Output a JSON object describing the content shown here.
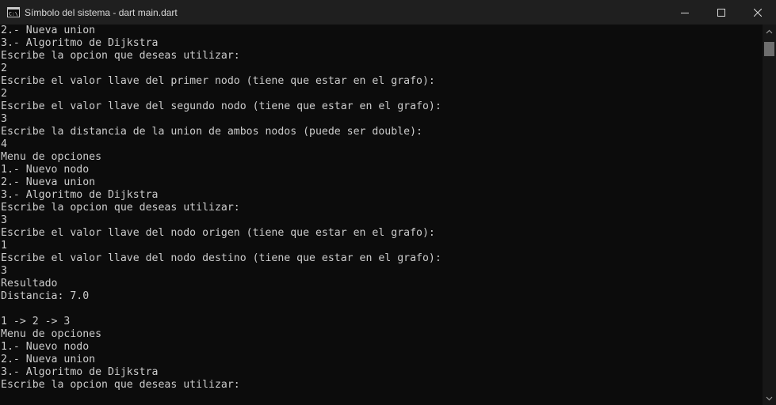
{
  "window": {
    "title": "Símbolo del sistema - dart  main.dart",
    "icon": "console-icon",
    "minimize_icon": "minimize-icon",
    "maximize_icon": "maximize-icon",
    "close_icon": "close-icon"
  },
  "console": {
    "lines": [
      "2.- Nueva union",
      "3.- Algoritmo de Dijkstra",
      "Escribe la opcion que deseas utilizar:",
      "2",
      "Escribe el valor llave del primer nodo (tiene que estar en el grafo):",
      "2",
      "Escribe el valor llave del segundo nodo (tiene que estar en el grafo):",
      "3",
      "Escribe la distancia de la union de ambos nodos (puede ser double):",
      "4",
      "Menu de opciones",
      "1.- Nuevo nodo",
      "2.- Nueva union",
      "3.- Algoritmo de Dijkstra",
      "Escribe la opcion que deseas utilizar:",
      "3",
      "Escribe el valor llave del nodo origen (tiene que estar en el grafo):",
      "1",
      "Escribe el valor llave del nodo destino (tiene que estar en el grafo):",
      "3",
      "Resultado",
      "Distancia: 7.0",
      "",
      "1 -> 2 -> 3",
      "Menu de opciones",
      "1.- Nuevo nodo",
      "2.- Nueva union",
      "3.- Algoritmo de Dijkstra",
      "Escribe la opcion que deseas utilizar:"
    ]
  },
  "colors": {
    "background": "#0c0c0c",
    "text": "#cccccc",
    "titlebar": "#1f1f1f"
  }
}
